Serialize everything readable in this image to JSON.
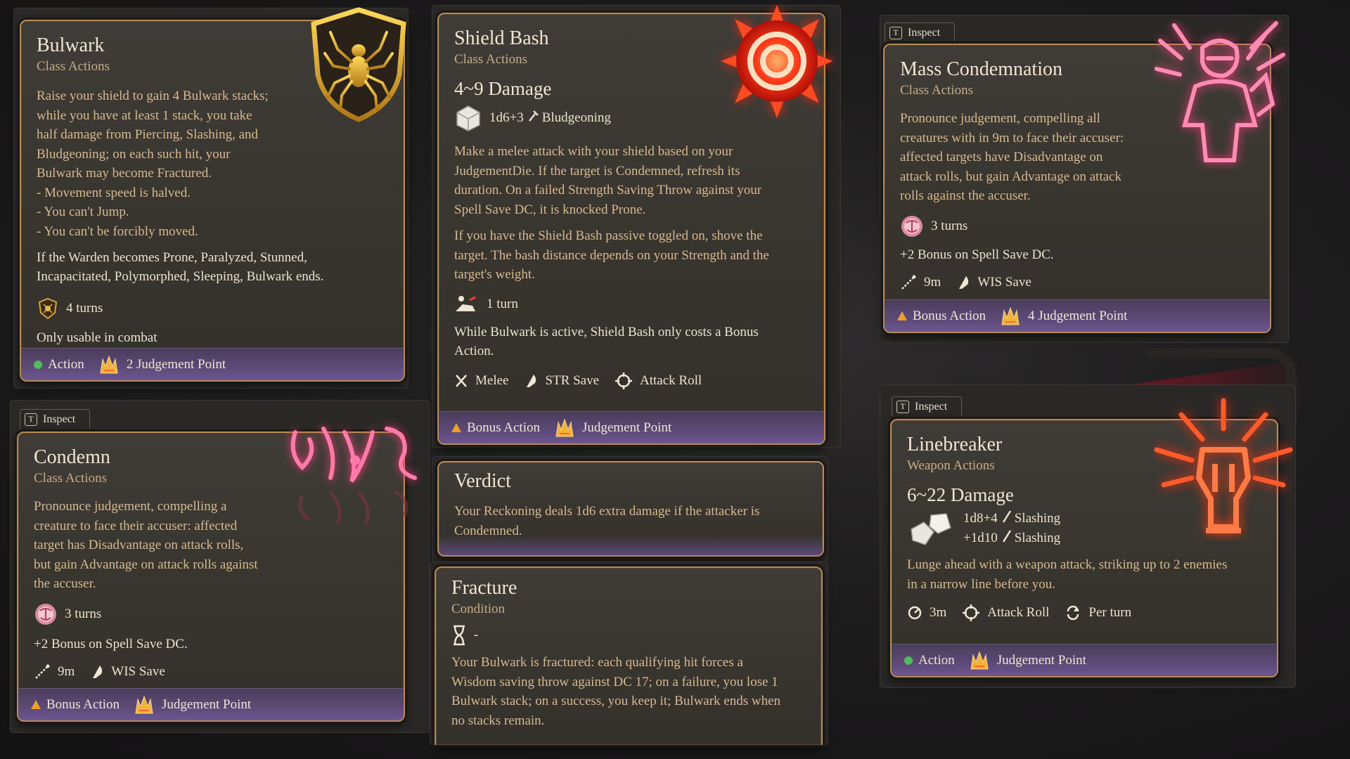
{
  "cards": {
    "bulwark": {
      "title": "Bulwark",
      "subtitle": "Class Actions",
      "desc_lines": [
        "Raise your shield to gain 4 Bulwark stacks;",
        "while you have at least 1 stack, you take",
        "half damage from Piercing, Slashing, and",
        "Bludgeoning; on each such hit, your",
        "Bulwark may become Fractured.",
        "- Movement speed is halved.",
        "- You can't Jump.",
        "- You can't be forcibly moved."
      ],
      "desc2_lines": [
        "If the Warden becomes Prone, Paralyzed, Stunned,",
        "Incapacitated, Polymorphed, Sleeping, Bulwark ends."
      ],
      "duration": "4 turns",
      "note": "Only usable in combat",
      "cost_action": "Action",
      "cost_resource": "2 Judgement Point"
    },
    "condemn": {
      "inspect": "Inspect",
      "inspect_key": "T",
      "title": "Condemn",
      "subtitle": "Class Actions",
      "desc_lines": [
        "Pronounce judgement, compelling a",
        "creature to face their accuser: affected",
        "target has Disadvantage on attack rolls,",
        "but gain Advantage on attack rolls against",
        "the accuser."
      ],
      "duration": "3 turns",
      "bonus": "+2 Bonus on Spell Save DC.",
      "range": "9m",
      "save": "WIS Save",
      "cost_action": "Bonus Action",
      "cost_resource": "Judgement Point"
    },
    "shield_bash": {
      "title": "Shield Bash",
      "subtitle": "Class Actions",
      "damage": "4~9 Damage",
      "dice": "1d6+3",
      "dmg_type": "Bludgeoning",
      "desc_lines": [
        "Make a melee attack with your shield based on your",
        "JudgementDie. If the target is Condemned, refresh its",
        "duration. On a failed Strength Saving Throw against your",
        "Spell Save DC, it is knocked Prone."
      ],
      "desc2_lines": [
        "If you have the Shield Bash passive toggled on, shove the",
        "target. The bash distance depends on your Strength and the",
        "target's weight."
      ],
      "duration": "1 turn",
      "note_lines": [
        "While Bulwark is active, Shield Bash only costs a Bonus",
        "Action."
      ],
      "range": "Melee",
      "save": "STR Save",
      "roll": "Attack Roll",
      "cost_action": "Bonus Action",
      "cost_resource": "Judgement Point"
    },
    "verdict": {
      "title": "Verdict",
      "desc_lines": [
        "Your Reckoning deals 1d6 extra damage if the attacker is",
        "Condemned."
      ]
    },
    "fracture": {
      "title": "Fracture",
      "subtitle": "Condition",
      "duration": "-",
      "desc_lines": [
        "Your Bulwark is fractured: each qualifying hit forces a",
        "Wisdom saving throw against DC 17; on a failure, you lose 1",
        "Bulwark stack; on a success, you keep it; Bulwark ends when",
        "no stacks remain."
      ]
    },
    "mass_condemnation": {
      "inspect": "Inspect",
      "inspect_key": "T",
      "title": "Mass Condemnation",
      "subtitle": "Class Actions",
      "desc_lines": [
        "Pronounce judgement, compelling all",
        "creatures with in 9m to face their accuser:",
        "affected targets have Disadvantage on",
        "attack rolls, but gain Advantage on attack",
        "rolls against the accuser."
      ],
      "duration": "3 turns",
      "bonus": "+2 Bonus on Spell Save DC.",
      "range": "9m",
      "save": "WIS Save",
      "cost_action": "Bonus Action",
      "cost_resource": "4 Judgement Point"
    },
    "linebreaker": {
      "inspect": "Inspect",
      "inspect_key": "T",
      "title": "Linebreaker",
      "subtitle": "Weapon Actions",
      "damage": "6~22 Damage",
      "dice1": "1d8+4",
      "dmg_type1": "Slashing",
      "dice2": "+1d10",
      "dmg_type2": "Slashing",
      "desc_lines": [
        "Lunge ahead with a weapon attack, striking up to 2 enemies",
        "in a narrow line before you."
      ],
      "range": "3m",
      "roll": "Attack Roll",
      "recharge": "Per turn",
      "cost_action": "Action",
      "cost_resource": "Judgement Point"
    }
  },
  "colors": {
    "accent_gold": "#b58a55",
    "highlight_text": "#f3ead9",
    "desc_text": "#d6b98f",
    "footer_purple": "#5d4a78",
    "action_dot": "#4fbe5a",
    "bonus_triangle": "#f0a02a",
    "glow_red": "#ff3b2a",
    "glow_pink": "#ff6f9a"
  },
  "icons": [
    "spider-shield-icon",
    "sun-sigil-icon",
    "condemn-rune-icon",
    "figure-rune-icon",
    "fist-burst-icon",
    "judgement-point-icon",
    "dice-icon",
    "range-icon",
    "save-icon",
    "attack-roll-icon",
    "melee-icon",
    "hourglass-icon",
    "recharge-icon",
    "prone-icon",
    "condemn-status-icon",
    "bulwark-status-icon"
  ]
}
